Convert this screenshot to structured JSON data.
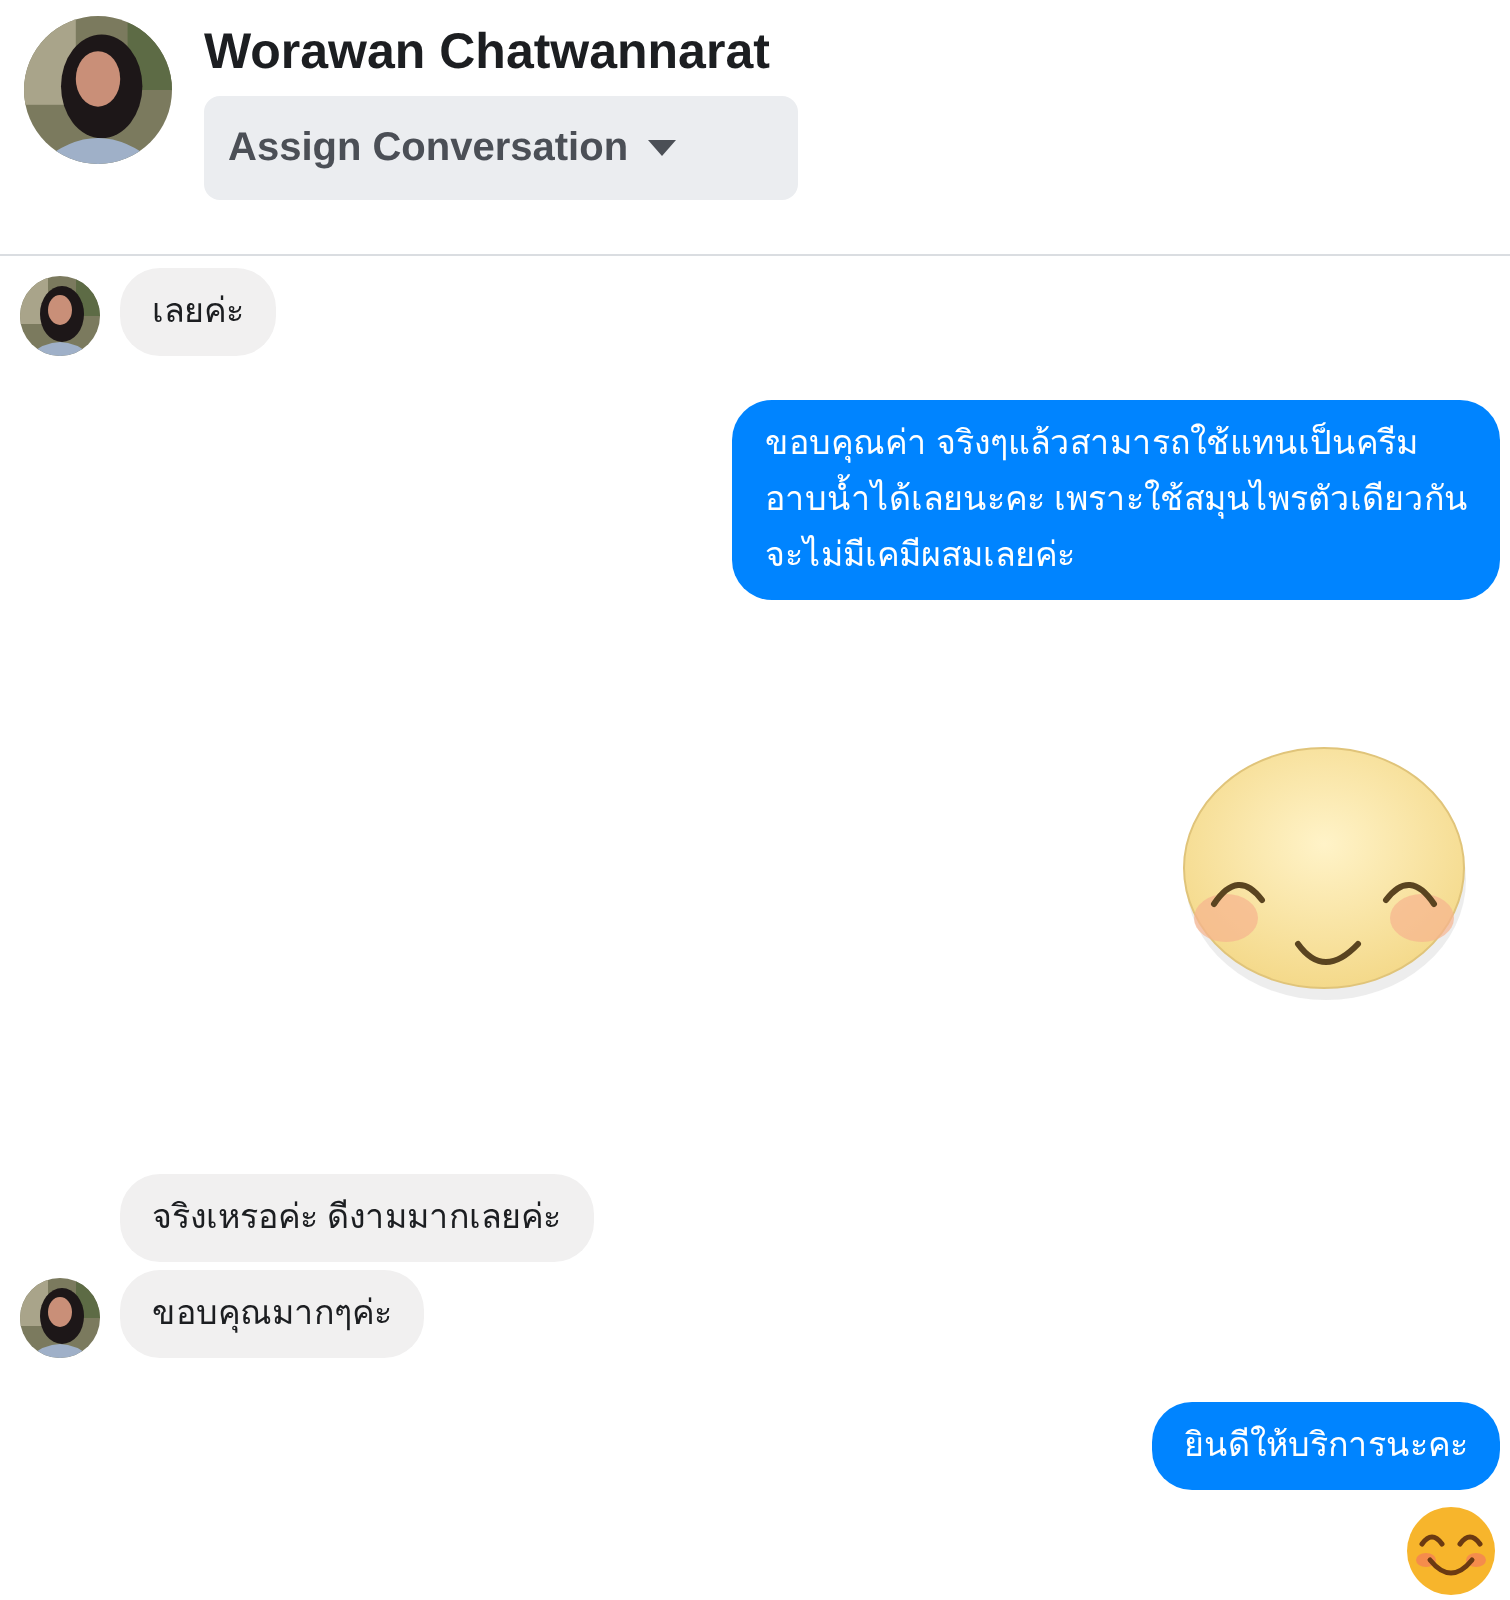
{
  "header": {
    "name": "Worawan Chatwannarat",
    "assign_button": "Assign Conversation"
  },
  "messages": [
    {
      "kind": "incoming",
      "text": "เลยค่ะ",
      "avatar": true
    },
    {
      "kind": "outgoing",
      "text": "ขอบคุณค่า จริงๆแล้วสามารถใช้แทนเป็นครีม\nอาบน้ำได้เลยนะคะ เพราะใช้สมุนไพรตัวเดียวกัน\nจะไม่มีเคมีผสมเลยค่ะ"
    },
    {
      "kind": "sticker"
    },
    {
      "kind": "incoming",
      "text": "จริงเหรอค่ะ ดีงามมากเลยค่ะ",
      "avatar": false
    },
    {
      "kind": "incoming",
      "text": "ขอบคุณมากๆค่ะ",
      "avatar": true
    },
    {
      "kind": "outgoing",
      "text": "ยินดีให้บริการนะคะ"
    },
    {
      "kind": "emoji"
    }
  ]
}
